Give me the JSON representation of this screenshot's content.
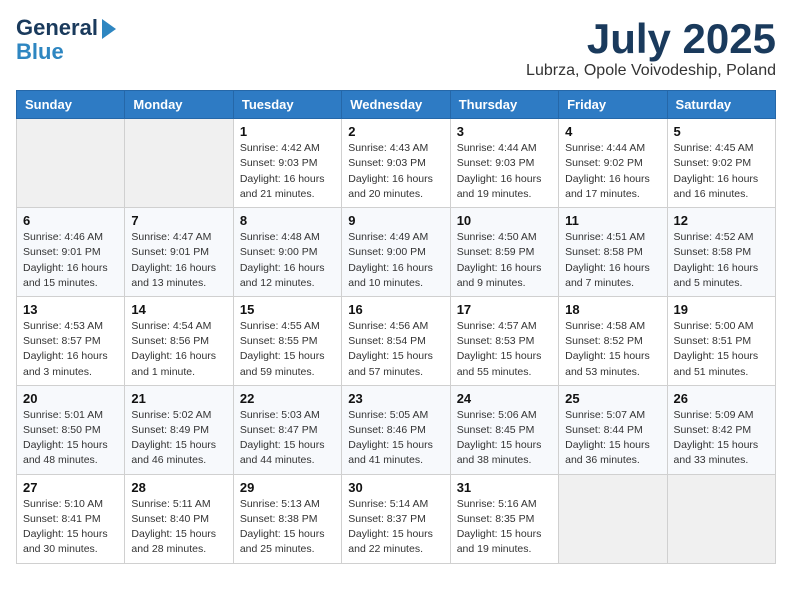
{
  "header": {
    "logo_line1": "General",
    "logo_line2": "Blue",
    "main_title": "July 2025",
    "subtitle": "Lubrza, Opole Voivodeship, Poland"
  },
  "days_of_week": [
    "Sunday",
    "Monday",
    "Tuesday",
    "Wednesday",
    "Thursday",
    "Friday",
    "Saturday"
  ],
  "weeks": [
    [
      {
        "day": "",
        "info": ""
      },
      {
        "day": "",
        "info": ""
      },
      {
        "day": "1",
        "info": "Sunrise: 4:42 AM\nSunset: 9:03 PM\nDaylight: 16 hours\nand 21 minutes."
      },
      {
        "day": "2",
        "info": "Sunrise: 4:43 AM\nSunset: 9:03 PM\nDaylight: 16 hours\nand 20 minutes."
      },
      {
        "day": "3",
        "info": "Sunrise: 4:44 AM\nSunset: 9:03 PM\nDaylight: 16 hours\nand 19 minutes."
      },
      {
        "day": "4",
        "info": "Sunrise: 4:44 AM\nSunset: 9:02 PM\nDaylight: 16 hours\nand 17 minutes."
      },
      {
        "day": "5",
        "info": "Sunrise: 4:45 AM\nSunset: 9:02 PM\nDaylight: 16 hours\nand 16 minutes."
      }
    ],
    [
      {
        "day": "6",
        "info": "Sunrise: 4:46 AM\nSunset: 9:01 PM\nDaylight: 16 hours\nand 15 minutes."
      },
      {
        "day": "7",
        "info": "Sunrise: 4:47 AM\nSunset: 9:01 PM\nDaylight: 16 hours\nand 13 minutes."
      },
      {
        "day": "8",
        "info": "Sunrise: 4:48 AM\nSunset: 9:00 PM\nDaylight: 16 hours\nand 12 minutes."
      },
      {
        "day": "9",
        "info": "Sunrise: 4:49 AM\nSunset: 9:00 PM\nDaylight: 16 hours\nand 10 minutes."
      },
      {
        "day": "10",
        "info": "Sunrise: 4:50 AM\nSunset: 8:59 PM\nDaylight: 16 hours\nand 9 minutes."
      },
      {
        "day": "11",
        "info": "Sunrise: 4:51 AM\nSunset: 8:58 PM\nDaylight: 16 hours\nand 7 minutes."
      },
      {
        "day": "12",
        "info": "Sunrise: 4:52 AM\nSunset: 8:58 PM\nDaylight: 16 hours\nand 5 minutes."
      }
    ],
    [
      {
        "day": "13",
        "info": "Sunrise: 4:53 AM\nSunset: 8:57 PM\nDaylight: 16 hours\nand 3 minutes."
      },
      {
        "day": "14",
        "info": "Sunrise: 4:54 AM\nSunset: 8:56 PM\nDaylight: 16 hours\nand 1 minute."
      },
      {
        "day": "15",
        "info": "Sunrise: 4:55 AM\nSunset: 8:55 PM\nDaylight: 15 hours\nand 59 minutes."
      },
      {
        "day": "16",
        "info": "Sunrise: 4:56 AM\nSunset: 8:54 PM\nDaylight: 15 hours\nand 57 minutes."
      },
      {
        "day": "17",
        "info": "Sunrise: 4:57 AM\nSunset: 8:53 PM\nDaylight: 15 hours\nand 55 minutes."
      },
      {
        "day": "18",
        "info": "Sunrise: 4:58 AM\nSunset: 8:52 PM\nDaylight: 15 hours\nand 53 minutes."
      },
      {
        "day": "19",
        "info": "Sunrise: 5:00 AM\nSunset: 8:51 PM\nDaylight: 15 hours\nand 51 minutes."
      }
    ],
    [
      {
        "day": "20",
        "info": "Sunrise: 5:01 AM\nSunset: 8:50 PM\nDaylight: 15 hours\nand 48 minutes."
      },
      {
        "day": "21",
        "info": "Sunrise: 5:02 AM\nSunset: 8:49 PM\nDaylight: 15 hours\nand 46 minutes."
      },
      {
        "day": "22",
        "info": "Sunrise: 5:03 AM\nSunset: 8:47 PM\nDaylight: 15 hours\nand 44 minutes."
      },
      {
        "day": "23",
        "info": "Sunrise: 5:05 AM\nSunset: 8:46 PM\nDaylight: 15 hours\nand 41 minutes."
      },
      {
        "day": "24",
        "info": "Sunrise: 5:06 AM\nSunset: 8:45 PM\nDaylight: 15 hours\nand 38 minutes."
      },
      {
        "day": "25",
        "info": "Sunrise: 5:07 AM\nSunset: 8:44 PM\nDaylight: 15 hours\nand 36 minutes."
      },
      {
        "day": "26",
        "info": "Sunrise: 5:09 AM\nSunset: 8:42 PM\nDaylight: 15 hours\nand 33 minutes."
      }
    ],
    [
      {
        "day": "27",
        "info": "Sunrise: 5:10 AM\nSunset: 8:41 PM\nDaylight: 15 hours\nand 30 minutes."
      },
      {
        "day": "28",
        "info": "Sunrise: 5:11 AM\nSunset: 8:40 PM\nDaylight: 15 hours\nand 28 minutes."
      },
      {
        "day": "29",
        "info": "Sunrise: 5:13 AM\nSunset: 8:38 PM\nDaylight: 15 hours\nand 25 minutes."
      },
      {
        "day": "30",
        "info": "Sunrise: 5:14 AM\nSunset: 8:37 PM\nDaylight: 15 hours\nand 22 minutes."
      },
      {
        "day": "31",
        "info": "Sunrise: 5:16 AM\nSunset: 8:35 PM\nDaylight: 15 hours\nand 19 minutes."
      },
      {
        "day": "",
        "info": ""
      },
      {
        "day": "",
        "info": ""
      }
    ]
  ]
}
